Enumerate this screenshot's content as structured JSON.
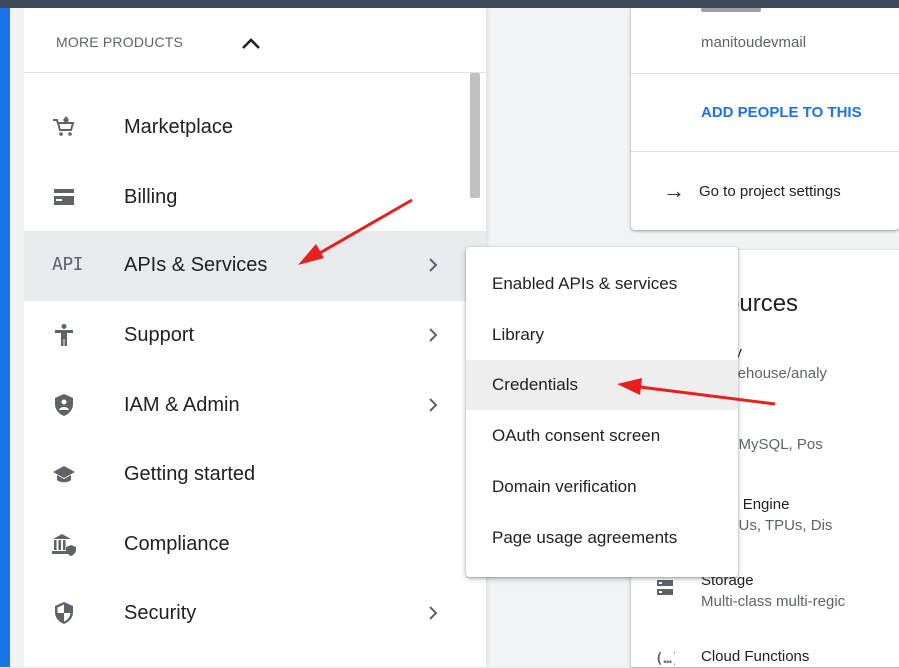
{
  "nav": {
    "header_label": "MORE PRODUCTS",
    "items": [
      {
        "label": "Marketplace",
        "icon": "cart-icon",
        "has_submenu": false
      },
      {
        "label": "Billing",
        "icon": "credit-card-icon",
        "has_submenu": false
      },
      {
        "label": "APIs & Services",
        "icon": "api-icon",
        "icon_text": "API",
        "has_submenu": true,
        "active": true
      },
      {
        "label": "Support",
        "icon": "person-icon",
        "has_submenu": true
      },
      {
        "label": "IAM & Admin",
        "icon": "shield-lock-icon",
        "has_submenu": true
      },
      {
        "label": "Getting started",
        "icon": "school-icon",
        "has_submenu": false
      },
      {
        "label": "Compliance",
        "icon": "bank-shield-icon",
        "has_submenu": false
      },
      {
        "label": "Security",
        "icon": "security-icon",
        "has_submenu": true
      }
    ]
  },
  "submenu": {
    "items": [
      {
        "label": "Enabled APIs & services"
      },
      {
        "label": "Library"
      },
      {
        "label": "Credentials",
        "highlighted": true
      },
      {
        "label": "OAuth consent screen"
      },
      {
        "label": "Domain verification"
      },
      {
        "label": "Page usage agreements"
      }
    ]
  },
  "project_card": {
    "email": "manitoudevmail",
    "add_people": "ADD PEOPLE TO THIS",
    "goto_settings": "Go to project settings"
  },
  "resources_card": {
    "title": "sources",
    "items": [
      {
        "name": "Query",
        "desc": "a warehouse/analy"
      },
      {
        "name": "",
        "desc": "aged MySQL, Pos"
      },
      {
        "name": "npute Engine",
        "desc": "s, GPUs, TPUs, Dis"
      },
      {
        "name": "Storage",
        "desc": "Multi-class multi-regic"
      },
      {
        "name": "Cloud Functions",
        "desc": ""
      }
    ]
  },
  "colors": {
    "accent": "#1a73e8",
    "annotation_arrow": "#e8201c",
    "active_row": "#e8eaed"
  }
}
